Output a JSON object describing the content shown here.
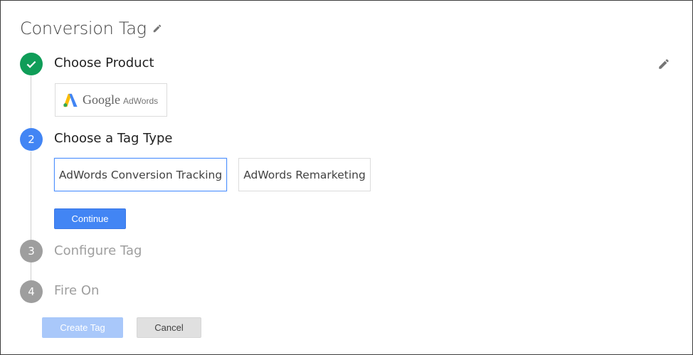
{
  "header": {
    "title": "Conversion Tag"
  },
  "steps": [
    {
      "number": "",
      "label": "Choose Product",
      "state": "complete"
    },
    {
      "number": "2",
      "label": "Choose a Tag Type",
      "state": "active"
    },
    {
      "number": "3",
      "label": "Configure Tag",
      "state": "inactive"
    },
    {
      "number": "4",
      "label": "Fire On",
      "state": "inactive"
    }
  ],
  "product": {
    "logo_google": "Google",
    "logo_adwords": "AdWords"
  },
  "tag_types": [
    {
      "label": "AdWords Conversion Tracking",
      "selected": true
    },
    {
      "label": "AdWords Remarketing",
      "selected": false
    }
  ],
  "buttons": {
    "continue": "Continue",
    "create_tag": "Create Tag",
    "cancel": "Cancel"
  },
  "colors": {
    "complete_green": "#0f9d58",
    "active_blue": "#4285f4",
    "inactive_gray": "#9e9e9e",
    "create_disabled": "#a9c8fa"
  },
  "icons": {
    "title_edit": "pencil-icon",
    "step_edit": "pencil-icon",
    "step1": "check-icon",
    "adwords_logo": "adwords-logo-icon"
  }
}
